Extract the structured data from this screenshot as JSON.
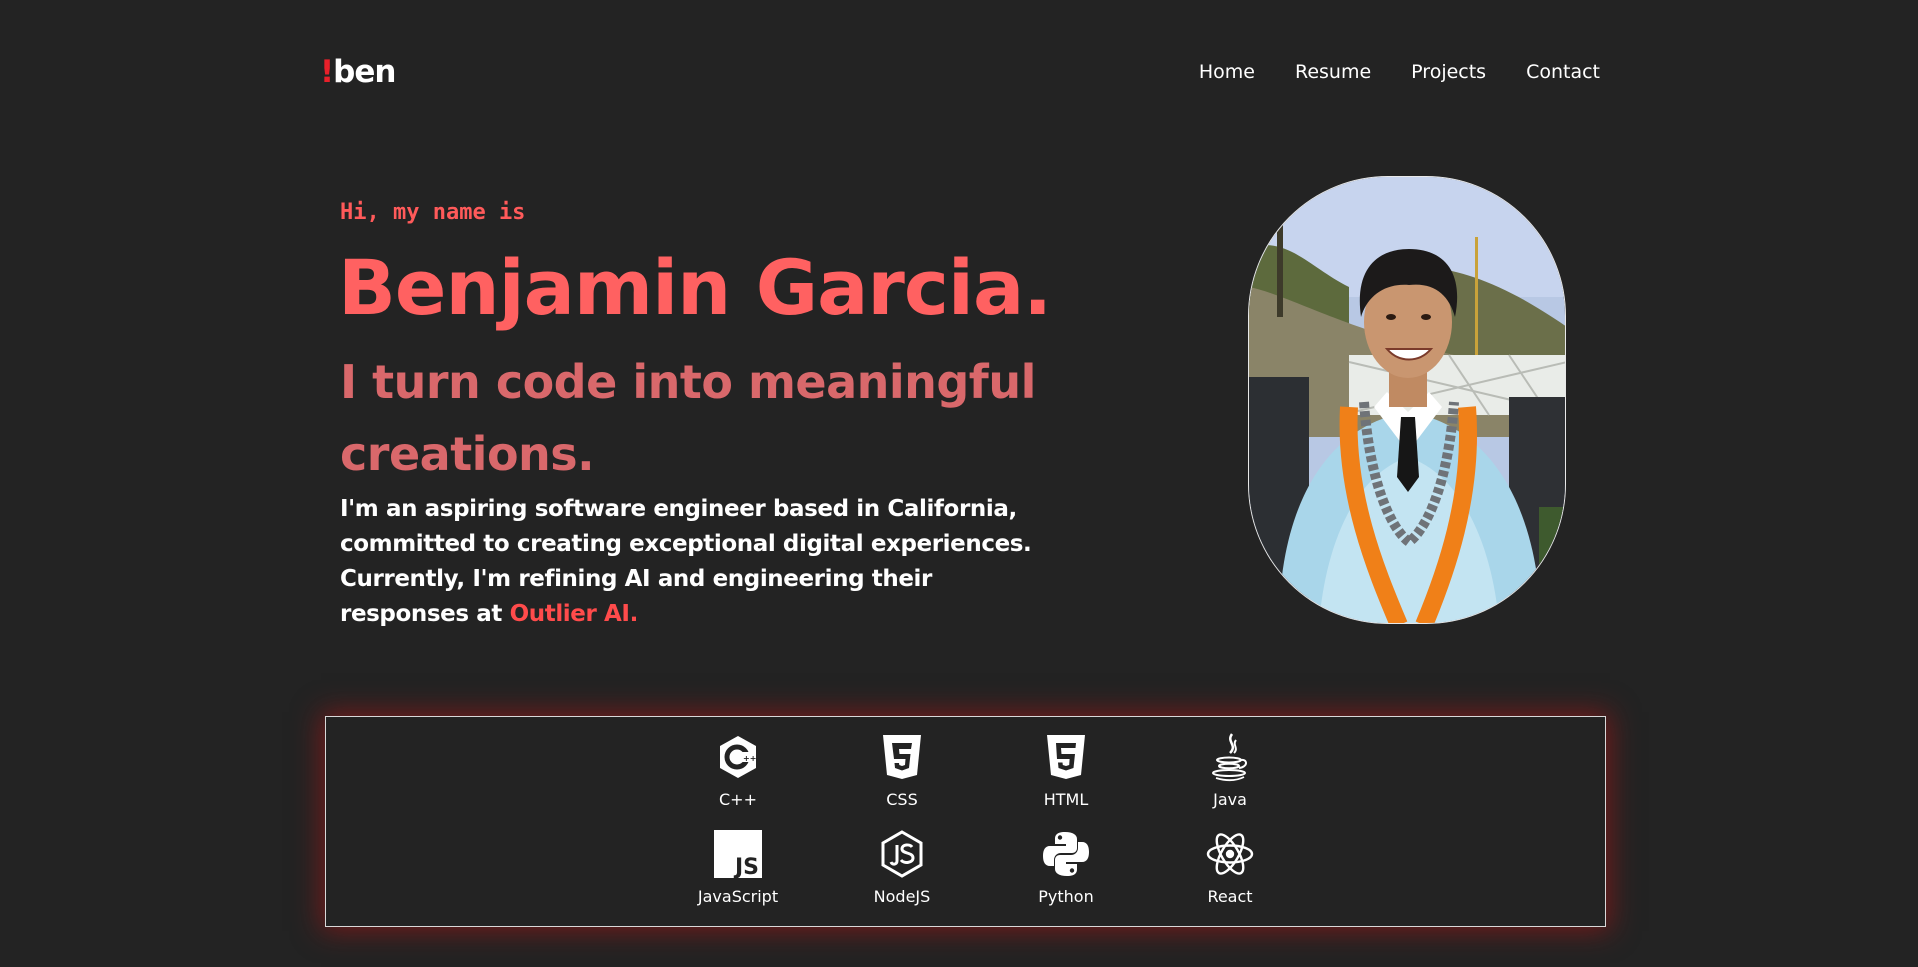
{
  "nav": {
    "logo_bang": "!",
    "logo_text": "ben",
    "links": [
      {
        "label": "Home"
      },
      {
        "label": "Resume"
      },
      {
        "label": "Projects"
      },
      {
        "label": "Contact"
      }
    ]
  },
  "hero": {
    "greeting": "Hi, my name is",
    "name": "Benjamin Garcia.",
    "tagline": "I turn code into meaningful creations.",
    "bio_text": "I'm an aspiring software engineer based in California, committed to creating exceptional digital experiences. Currently, I'm refining AI and engineering their responses at ",
    "bio_company": "Outlier AI."
  },
  "photo": {
    "icon": "profile-photo"
  },
  "skills": [
    {
      "label": "C++",
      "icon": "cplusplus-icon"
    },
    {
      "label": "CSS",
      "icon": "css3-icon"
    },
    {
      "label": "HTML",
      "icon": "html5-icon"
    },
    {
      "label": "Java",
      "icon": "java-icon"
    },
    {
      "label": "JavaScript",
      "icon": "javascript-icon"
    },
    {
      "label": "NodeJS",
      "icon": "nodejs-icon"
    },
    {
      "label": "Python",
      "icon": "python-icon"
    },
    {
      "label": "React",
      "icon": "react-icon"
    }
  ],
  "colors": {
    "background": "#232323",
    "accent_red": "#ff6161",
    "logo_red": "#e8202a",
    "tagline": "#d9686b",
    "link_red": "#ff4b4b"
  }
}
